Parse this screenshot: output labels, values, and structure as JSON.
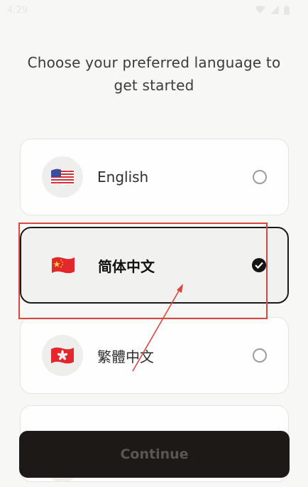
{
  "status_bar": {
    "time": "4:29"
  },
  "heading": "Choose your preferred language to get started",
  "languages": [
    {
      "label": "English",
      "flag": "us-flag-icon",
      "selected": false
    },
    {
      "label": "简体中文",
      "flag": "china-flag-icon",
      "selected": true
    },
    {
      "label": "繁體中文",
      "flag": "hong-kong-flag-icon",
      "selected": false
    },
    {
      "label": "",
      "flag": "flag-icon",
      "selected": false
    }
  ],
  "continue_button": {
    "label": "Continue"
  },
  "colors": {
    "background": "#f7f7f6",
    "button_bg": "#1c1917",
    "annotation": "#d9473f"
  }
}
